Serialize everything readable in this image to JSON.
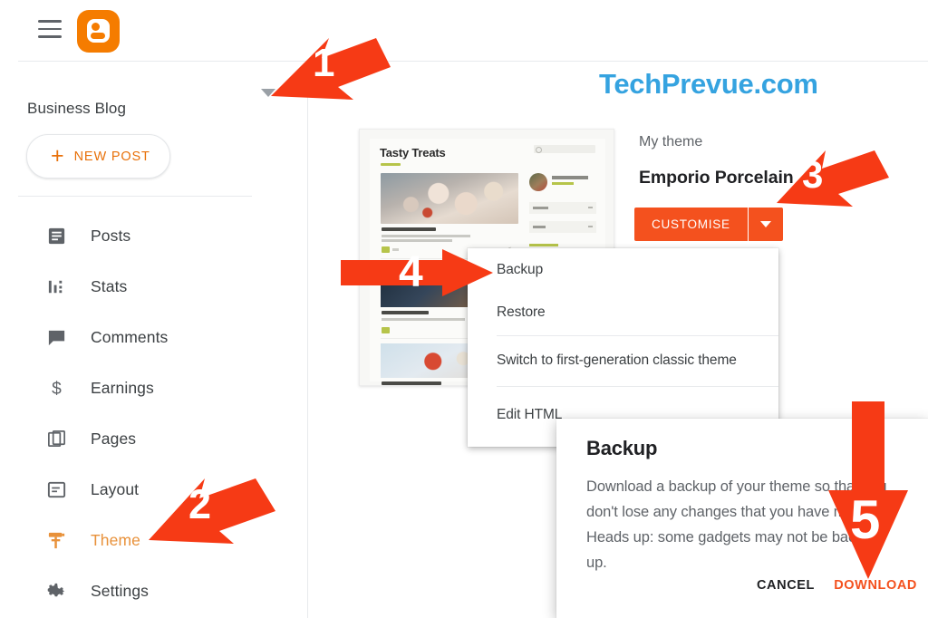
{
  "app": {
    "name": "Blogger",
    "logo_icon": "blogger-logo-icon",
    "menu_icon": "hamburger-menu-icon"
  },
  "watermark": {
    "text": "TechPrevue.com",
    "color": "#35a3e0"
  },
  "sidebar": {
    "blog_name": "Business Blog",
    "blog_selector_icon": "chevron-down-icon",
    "new_post": {
      "label": "NEW POST",
      "icon": "plus-icon"
    },
    "items": [
      {
        "label": "Posts",
        "icon": "posts-icon",
        "active": false
      },
      {
        "label": "Stats",
        "icon": "stats-bar-icon",
        "active": false
      },
      {
        "label": "Comments",
        "icon": "comment-icon",
        "active": false
      },
      {
        "label": "Earnings",
        "icon": "dollar-icon",
        "active": false
      },
      {
        "label": "Pages",
        "icon": "pages-icon",
        "active": false
      },
      {
        "label": "Layout",
        "icon": "layout-icon",
        "active": false
      },
      {
        "label": "Theme",
        "icon": "paint-roller-icon",
        "active": true
      },
      {
        "label": "Settings",
        "icon": "gear-icon",
        "active": false
      }
    ]
  },
  "main": {
    "my_theme_label": "My theme",
    "theme_name": "Emporio Porcelain",
    "customise_button": {
      "label": "CUSTOMISE",
      "caret_icon": "chevron-down-icon",
      "color": "#f4511e"
    },
    "theme_preview": {
      "blog_title": "Tasty Treats",
      "search_icon": "search-icon",
      "share_icon": "share-icon"
    },
    "dropdown_menu": {
      "items": [
        {
          "label": "Backup"
        },
        {
          "label": "Restore"
        },
        {
          "label": "Switch to first-generation classic theme"
        },
        {
          "label": "Edit HTML"
        }
      ]
    },
    "dialog": {
      "title": "Backup",
      "body": "Download a backup of your theme so that you don't lose any changes that you have made. Heads up: some gadgets may not be backed up.",
      "cancel_label": "CANCEL",
      "download_label": "DOWNLOAD",
      "download_color": "#f4511e"
    }
  },
  "annotations": {
    "color": "#f63a15",
    "steps": [
      {
        "number": "1",
        "points_to": "blog-selector-chevron",
        "direction": "down-left"
      },
      {
        "number": "2",
        "points_to": "sidebar-item-theme",
        "direction": "down-left"
      },
      {
        "number": "3",
        "points_to": "customise-dropdown-caret",
        "direction": "down-left"
      },
      {
        "number": "4",
        "points_to": "menu-item-backup",
        "direction": "right"
      },
      {
        "number": "5",
        "points_to": "dialog-download-button",
        "direction": "down"
      }
    ]
  }
}
